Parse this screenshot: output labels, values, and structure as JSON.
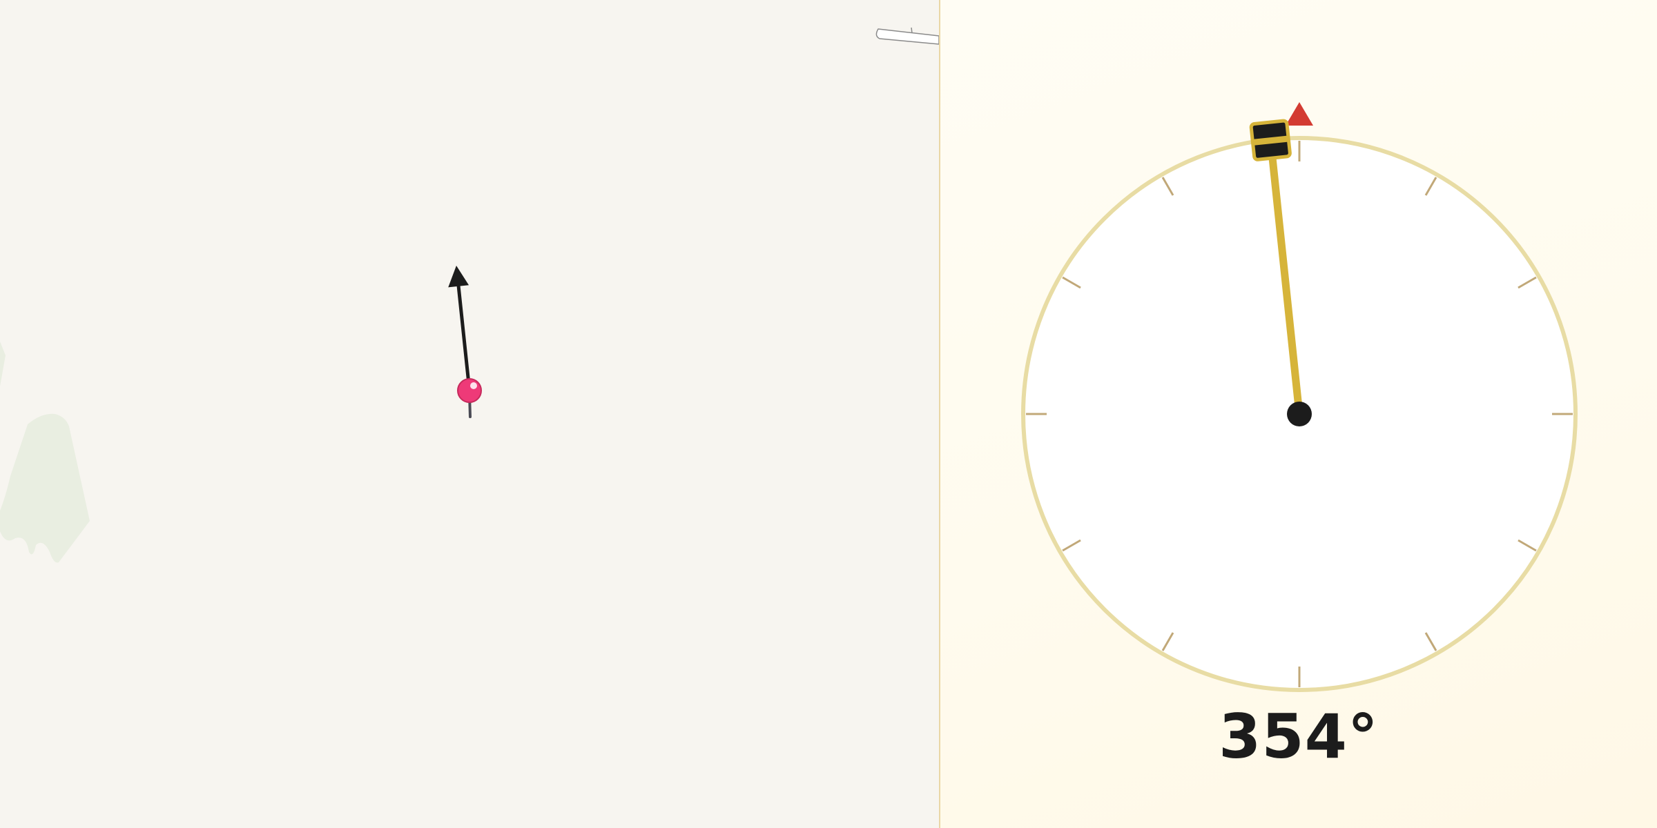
{
  "compass": {
    "heading_deg": 354,
    "heading_text": "354°",
    "tick_count": 12
  },
  "map": {
    "direction_deg": 354
  },
  "icons": {
    "map_pin": "map-pin-icon",
    "direction_arrow": "direction-arrow-icon",
    "north_marker": "north-triangle-icon",
    "drag_handle": "drag-handle-icon"
  },
  "colors": {
    "map_background": "#f7f5f0",
    "land_patch": "#e9eee1",
    "pin": "#ee3a78",
    "arrow": "#1c1c1c",
    "dial_ring": "#e8dca4",
    "tick": "#c1a878",
    "needle": "#d6b43a",
    "north_marker": "#d33b32",
    "hub": "#1c1c1c",
    "readout_text": "#1c1c1c"
  }
}
